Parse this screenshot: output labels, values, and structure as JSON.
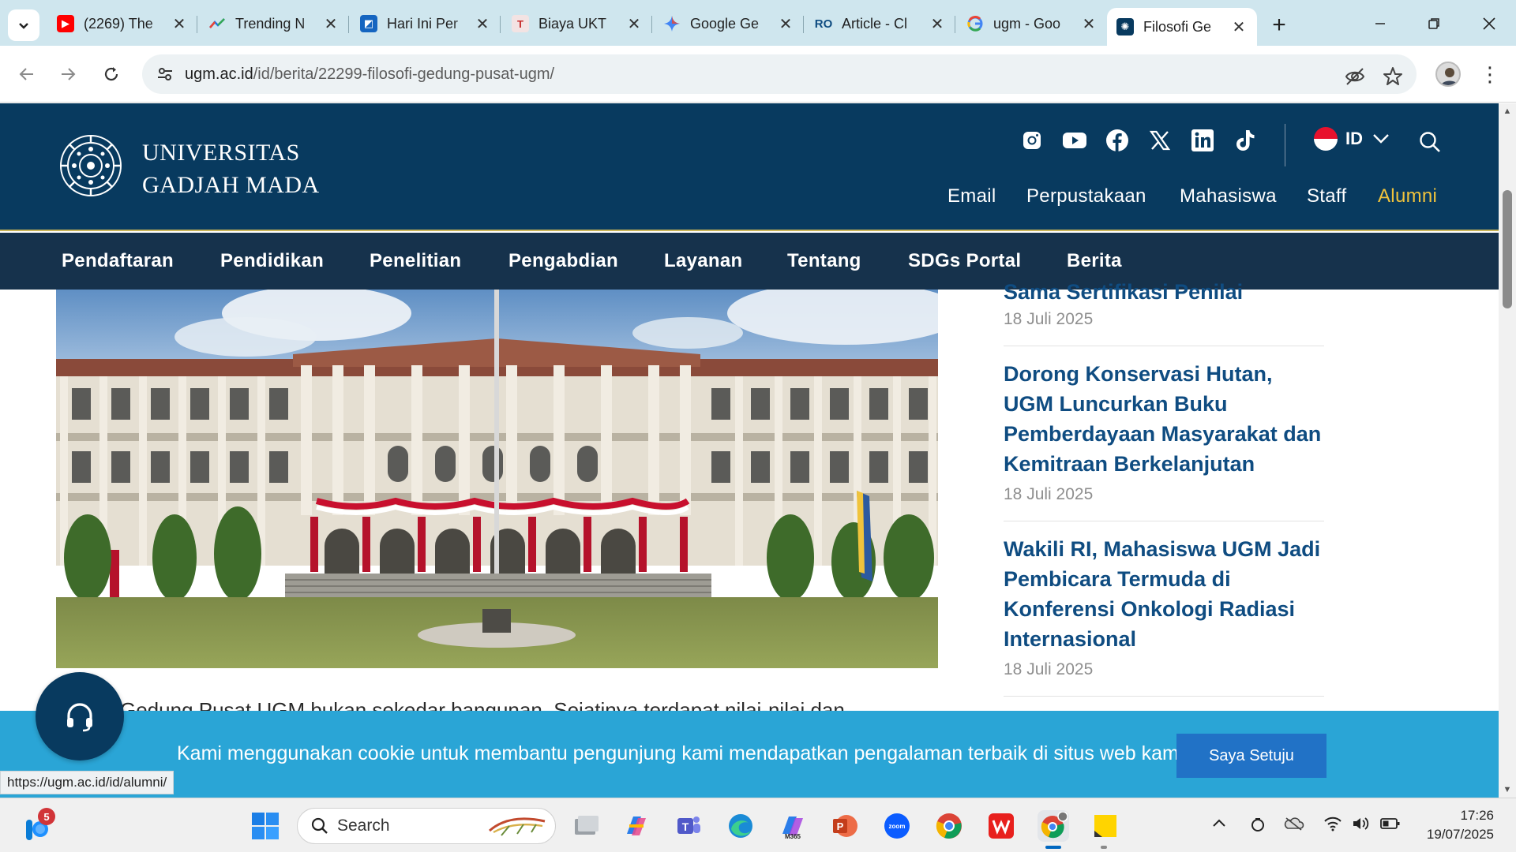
{
  "browser": {
    "tabs": [
      {
        "title": "(2269) The",
        "icon": "youtube-icon",
        "color": "#ff0000"
      },
      {
        "title": "Trending N",
        "icon": "trending-icon",
        "color": "#1a73e8"
      },
      {
        "title": "Hari Ini Per",
        "icon": "news-icon",
        "color": "#f5a623"
      },
      {
        "title": "Biaya UKT",
        "icon": "t-icon",
        "color": "#d93025"
      },
      {
        "title": "Google Ge",
        "icon": "gemini-icon",
        "color": "#4285f4"
      },
      {
        "title": "Article - Cl",
        "icon": "article-icon",
        "color": "#0f4c81"
      },
      {
        "title": "ugm - Goo",
        "icon": "google-icon",
        "color": "#4285f4"
      },
      {
        "title": "Filosofi Ge",
        "icon": "ugm-icon",
        "color": "#083a5f"
      }
    ],
    "address": {
      "domain": "ugm.ac.id",
      "path": "/id/berita/22299-filosofi-gedung-pusat-ugm/"
    },
    "status_url": "https://ugm.ac.id/id/alumni/"
  },
  "site": {
    "name_line1": "UNIVERSITAS",
    "name_line2": "GADJAH MADA",
    "social_icons": [
      "instagram-icon",
      "youtube-icon",
      "facebook-icon",
      "x-icon",
      "linkedin-icon",
      "tiktok-icon"
    ],
    "language": "ID",
    "quick_links": [
      "Email",
      "Perpustakaan",
      "Mahasiswa",
      "Staff",
      "Alumni"
    ],
    "nav": [
      "Pendaftaran",
      "Pendidikan",
      "Penelitian",
      "Pengabdian",
      "Layanan",
      "Tentang",
      "SDGs Portal",
      "Berita"
    ],
    "colors": {
      "header": "#083a5f",
      "nav": "#16324c",
      "accent": "#f0c33c",
      "link": "#0f4c81",
      "cookie": "#2aa5d6"
    }
  },
  "sidebar": {
    "partial_title": "Sama Sertifikasi Penilai",
    "partial_date": "18 Juli 2025",
    "news": [
      {
        "title": "Dorong Konservasi Hutan, UGM Luncurkan Buku Pemberdayaan Masyarakat dan Kemitraan Berkelanjutan",
        "date": "18 Juli 2025"
      },
      {
        "title": "Wakili RI, Mahasiswa UGM Jadi Pembicara Termuda di Konferensi Onkologi Radiasi Internasional",
        "date": "18 Juli 2025"
      }
    ]
  },
  "article": {
    "intro": "Gedung Pusat UGM bukan sekedar bangunan. Sejatinya terdapat nilai-nilai dan"
  },
  "cookie": {
    "text": "Kami menggunakan cookie untuk membantu pengunjung kami mendapatkan pengalaman terbaik di situs web kami.",
    "button": "Saya Setuju"
  },
  "taskbar": {
    "search_label": "Search",
    "notification_count": "5",
    "time": "17:26",
    "date": "19/07/2025",
    "apps": [
      "start-icon",
      "task-view-icon",
      "copilot-icon",
      "teams-icon",
      "edge-icon",
      "m365-icon",
      "powerpoint-icon",
      "zoom-icon",
      "chrome-icon",
      "wps-icon",
      "chrome-profile-icon",
      "sticky-notes-icon"
    ]
  }
}
